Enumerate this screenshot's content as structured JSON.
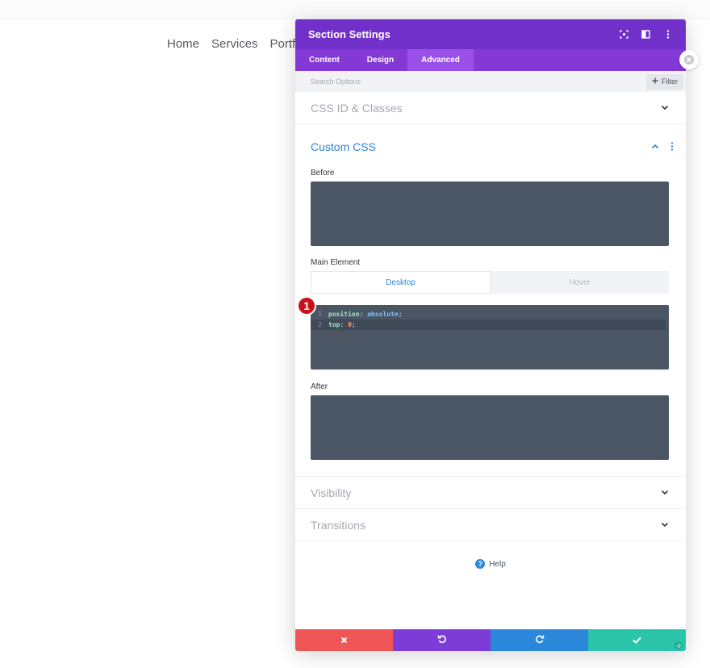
{
  "site_nav": {
    "items": [
      "Home",
      "Services",
      "Portfo"
    ]
  },
  "panel": {
    "title": "Section Settings",
    "tabs": [
      {
        "label": "Content",
        "active": false
      },
      {
        "label": "Design",
        "active": false
      },
      {
        "label": "Advanced",
        "active": true
      }
    ],
    "search": {
      "placeholder": "Search Options",
      "filter_label": "Filter"
    },
    "groups": {
      "css_id": "CSS ID & Classes",
      "custom_css": "Custom CSS",
      "visibility": "Visibility",
      "transitions": "Transitions"
    },
    "custom_css": {
      "before_label": "Before",
      "main_label": "Main Element",
      "after_label": "After",
      "state_tabs": {
        "desktop": "Desktop",
        "hover": "Hover"
      },
      "code": [
        {
          "line": "1",
          "prop": "position",
          "sep": ": ",
          "value": "absolute",
          "end": ";"
        },
        {
          "line": "2",
          "prop": "top",
          "sep": ": ",
          "value": "0",
          "end": ";"
        }
      ],
      "step_marker": "1"
    },
    "help_label": "Help"
  },
  "colors": {
    "header": "#7030c9",
    "tabs": "#8439d6",
    "accent_blue": "#2b87da",
    "discard": "#ef5555",
    "undo": "#7d3bd7",
    "redo": "#2b87da",
    "save": "#29c4a9",
    "editor_bg": "#4b5665",
    "step_marker": "#c81118"
  },
  "icons": {
    "header": [
      "target-icon",
      "columns-icon",
      "more-vertical-icon"
    ],
    "footer": [
      "close-icon",
      "undo-icon",
      "redo-icon",
      "check-icon"
    ]
  }
}
